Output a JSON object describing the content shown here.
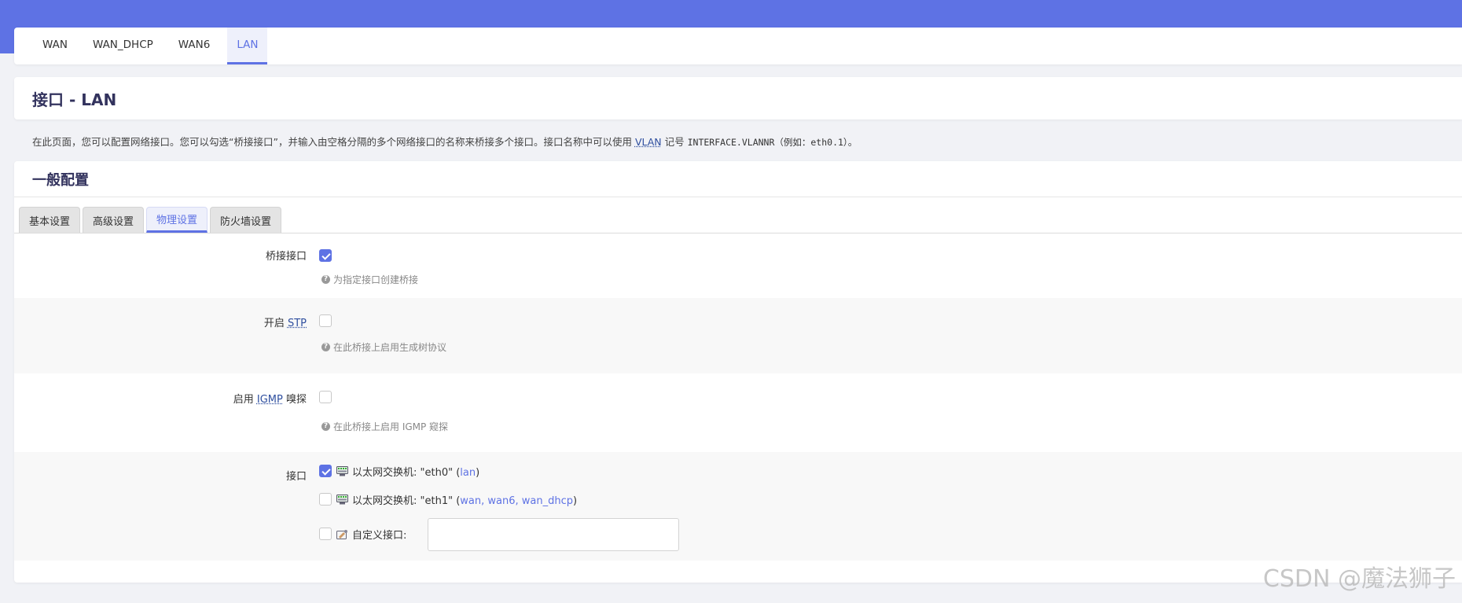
{
  "iface_tabs": [
    {
      "label": "WAN"
    },
    {
      "label": "WAN_DHCP"
    },
    {
      "label": "WAN6"
    },
    {
      "label": "LAN",
      "active": true
    }
  ],
  "page_title": "接口 - LAN",
  "description": {
    "before_vlan": "在此页面，您可以配置网络接口。您可以勾选“桥接接口”，并输入由空格分隔的多个网络接口的名称来桥接多个接口。接口名称中可以使用 ",
    "vlan": "VLAN",
    "mid": " 记号 ",
    "code": "INTERFACE.VLANNR（例如：eth0.1）",
    "end": "。"
  },
  "section_title": "一般配置",
  "sub_tabs": [
    {
      "label": "基本设置"
    },
    {
      "label": "高级设置"
    },
    {
      "label": "物理设置",
      "active": true
    },
    {
      "label": "防火墙设置"
    }
  ],
  "fields": {
    "bridge": {
      "label": "桥接接口",
      "checked": true,
      "hint": "为指定接口创建桥接"
    },
    "stp": {
      "label_prefix": "开启 ",
      "label_abbr": "STP",
      "checked": false,
      "hint": "在此桥接上启用生成树协议"
    },
    "igmp": {
      "label_prefix": "启用 ",
      "label_abbr": "IGMP",
      "label_suffix": " 嗅探",
      "checked": false,
      "hint": "在此桥接上启用 IGMP 窥探"
    },
    "interfaces": {
      "label": "接口",
      "options": [
        {
          "text": "以太网交换机: \"eth0\" (",
          "networks": "lan",
          "close": ")",
          "checked": true
        },
        {
          "text": "以太网交换机: \"eth1\" (",
          "networks": "wan, wan6, wan_dhcp",
          "close": ")",
          "checked": false
        }
      ],
      "custom": {
        "label": "自定义接口:",
        "value": "",
        "checked": false
      }
    }
  },
  "hint_icon": "?",
  "watermark": "CSDN @魔法狮子",
  "colors": {
    "accent": "#5e72e4",
    "link": "#2f4f9f"
  },
  "icons": {
    "switch": "ethernet-switch-icon",
    "custom": "custom-interface-icon",
    "help": "question-circle-icon"
  }
}
